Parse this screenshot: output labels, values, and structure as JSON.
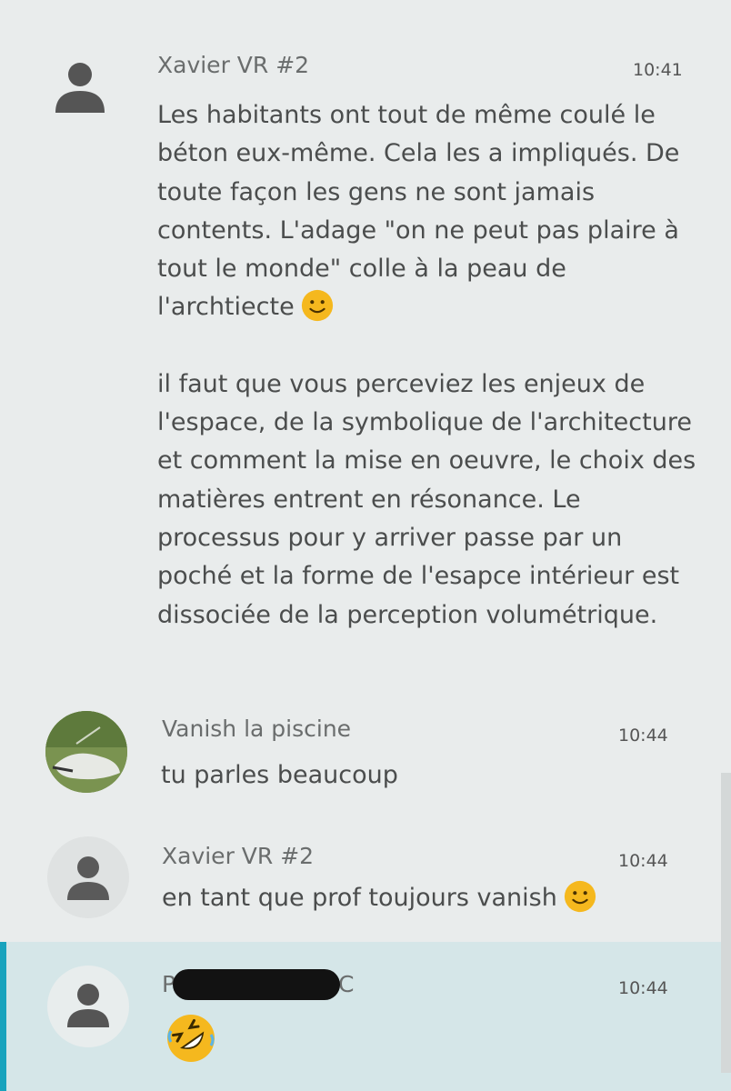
{
  "messages": [
    {
      "author": "Xavier VR #2",
      "time": "10:41",
      "paragraph1": "Les habitants ont tout de même coulé le béton eux-même. Cela les a impliqués. De toute façon les gens ne sont jamais contents. L'adage \"on ne peut pas plaire à tout le monde\" colle à la peau de l'archtiecte",
      "paragraph2": "il faut que vous perceviez les enjeux de l'espace, de la symbolique de l'architecture et comment la mise en oeuvre, le choix des matières entrent en résonance. Le processus pour y arriver passe par un poché et la forme de l'esapce intérieur est dissociée de la perception volumétrique.",
      "emoji": "smile-emoji"
    },
    {
      "author": "Vanish la piscine",
      "time": "10:44",
      "text": "tu parles beaucoup"
    },
    {
      "author": "Xavier VR #2",
      "time": "10:44",
      "text": "en tant que prof toujours vanish",
      "emoji": "smile-emoji"
    },
    {
      "author_first_letter": "P",
      "author_last_letter": "C",
      "time": "10:44",
      "emoji": "rolling-laughing-emoji"
    }
  ],
  "colors": {
    "background": "#e9ecec",
    "highlight": "#d5e6e8",
    "accent_bar": "#18a3bd",
    "emoji_yellow": "#f5b81e"
  }
}
